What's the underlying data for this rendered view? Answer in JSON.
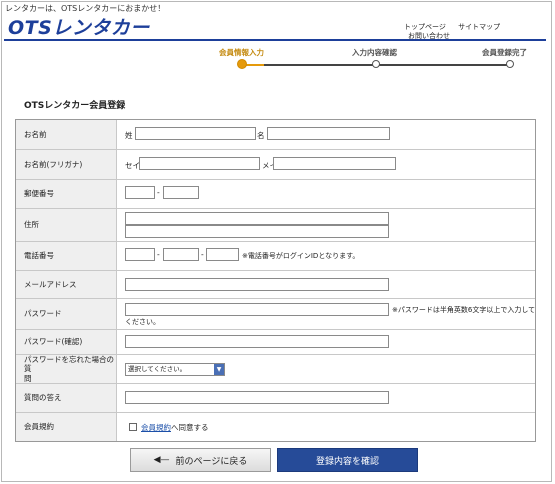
{
  "header": {
    "tagline": "レンタカーは、OTSレンタカーにおまかせ！",
    "logo_text": "OTSレンタカー",
    "top_links": [
      "トップページ",
      "サイトマップ"
    ],
    "top_links_sub": "お問い合わせ"
  },
  "steps": [
    {
      "label": "会員情報入力",
      "active": true
    },
    {
      "label": "入力内容確認",
      "active": false
    },
    {
      "label": "会員登録完了",
      "active": false
    }
  ],
  "form": {
    "title": "OTSレンタカー会員登録",
    "rows": {
      "name": {
        "label": "お名前",
        "last_label": "姓",
        "first_label": "名"
      },
      "kana": {
        "label": "お名前(フリガナ)",
        "last_label": "セイ",
        "first_label": "メイ"
      },
      "postal": {
        "label": "郵便番号",
        "sep": "-"
      },
      "address": {
        "label": "住所"
      },
      "phone": {
        "label": "電話番号",
        "sep": "-",
        "note": "※電話番号がログインIDとなります。"
      },
      "email": {
        "label": "メールアドレス"
      },
      "password": {
        "label": "パスワード",
        "note_line1": "※パスワードは半角英数6文字以上で入力して",
        "note_line2": "ください。"
      },
      "password_confirm": {
        "label": "パスワード(確認)"
      },
      "secret_question": {
        "label_line1": "パスワードを忘れた場合の質",
        "label_line2": "問",
        "selected": "選択してください。"
      },
      "secret_answer": {
        "label": "質問の答え"
      },
      "terms": {
        "label": "会員規約",
        "link_text": "会員規約",
        "suffix": "へ同意する"
      }
    }
  },
  "buttons": {
    "back": "前のページに戻る",
    "confirm": "登録内容を確認"
  },
  "colors": {
    "brand_blue": "#1d3f9a",
    "step_active": "#e59a0c",
    "confirm_button": "#264b98"
  },
  "icons": {
    "back_arrow": "left-arrow-icon",
    "select_arrow": "chevron-down-icon"
  }
}
